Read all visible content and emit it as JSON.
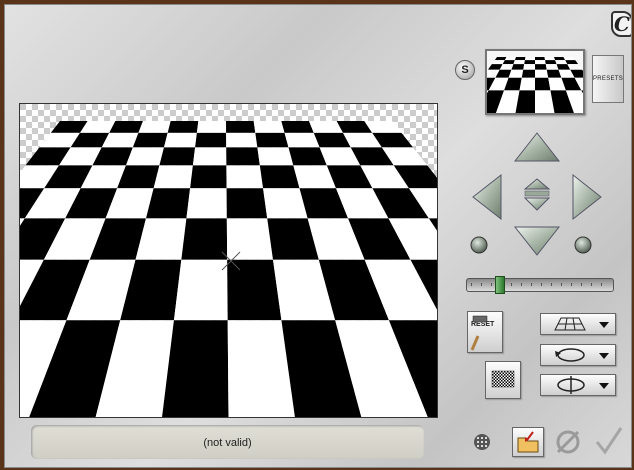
{
  "status": {
    "text": "(not valid)"
  },
  "controls": {
    "s_label": "S",
    "presets_label": "PRESETS",
    "reset_label": "RESET",
    "slider_value": 0.2
  },
  "colors": {
    "checker_dark": "#000000",
    "checker_light": "#ffffff",
    "accent_green": "#2d7a2d",
    "frame_brown": "#5a3418"
  },
  "icons": {
    "logo": "corel-c-logo",
    "arrows": [
      "arrow-up-icon",
      "arrow-left-icon",
      "arrow-right-icon",
      "arrow-down-icon",
      "center-up-icon",
      "center-down-icon"
    ],
    "rotate": [
      "rotate-left-icon",
      "rotate-right-icon"
    ],
    "dropdowns": [
      "grid-plane-icon",
      "rotate-circle-icon",
      "flip-vertical-icon"
    ],
    "bottom": [
      "grid-dots-icon",
      "open-folder-icon",
      "cancel-icon",
      "ok-check-icon"
    ]
  }
}
